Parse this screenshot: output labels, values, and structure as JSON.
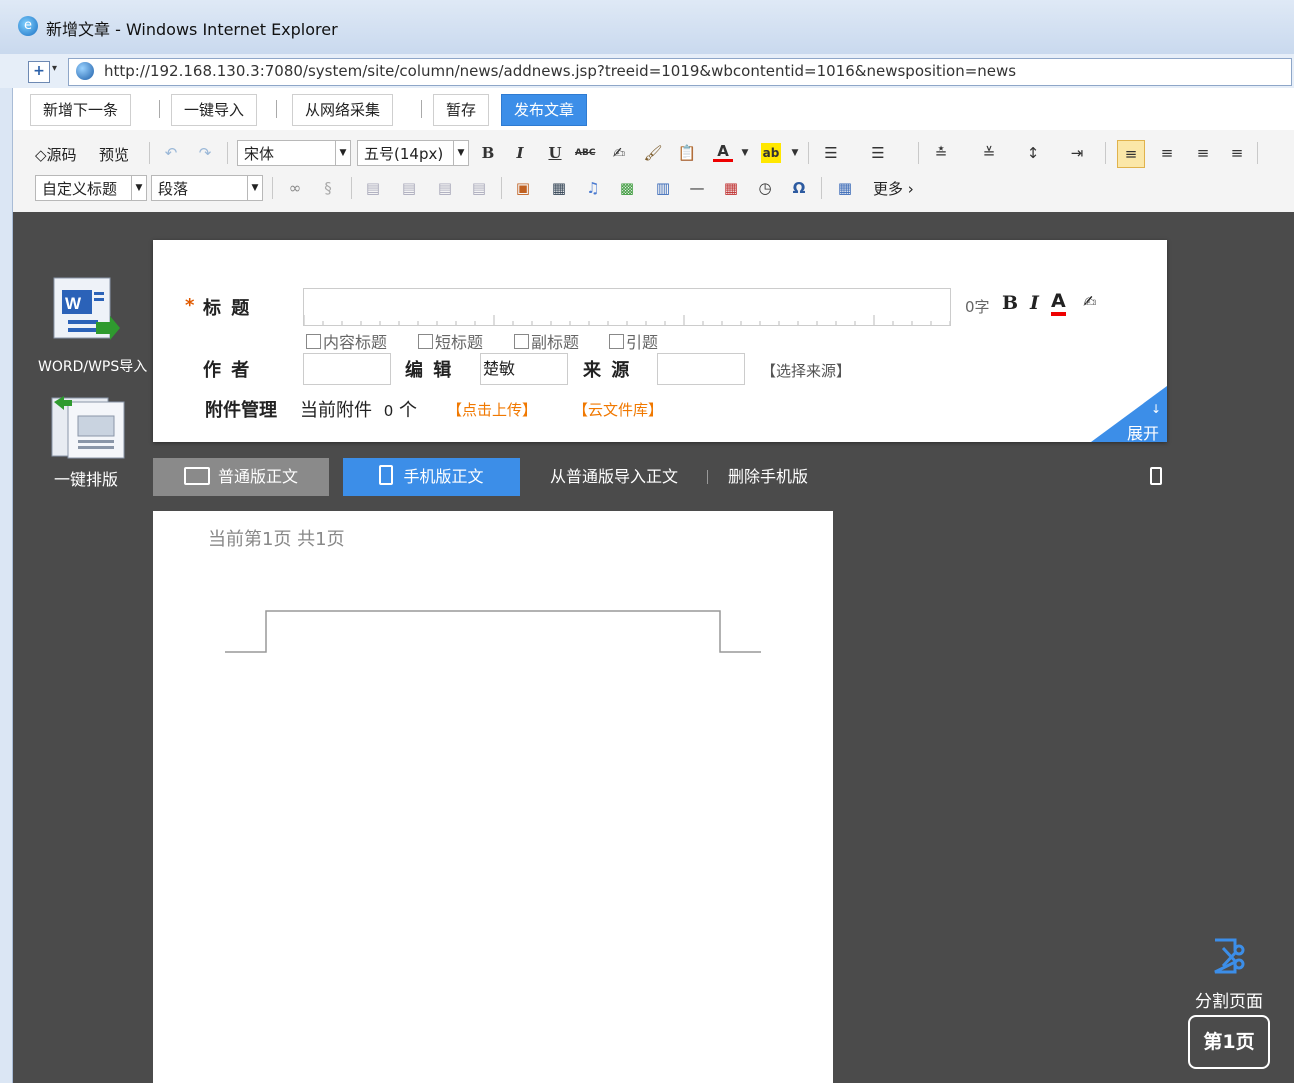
{
  "window": {
    "title": "新增文章 - Windows Internet Explorer"
  },
  "address": {
    "url": "http://192.168.130.3:7080/system/site/column/news/addnews.jsp?treeid=1019&wbcontentid=1016&newsposition=news"
  },
  "actions": {
    "add_next": "新增下一条",
    "import": "一键导入",
    "collect": "从网络采集",
    "save_draft": "暂存",
    "publish": "发布文章"
  },
  "toolbar": {
    "source": "◇源码",
    "preview": "预览",
    "font": "宋体",
    "size": "五号(14px)",
    "bold": "B",
    "italic": "I",
    "underline": "U",
    "strike": "ABC",
    "font_color": "A",
    "custom_heading": "自定义标题",
    "paragraph": "段落",
    "more": "更多 ›",
    "omega": "Ω"
  },
  "sidebar": {
    "word_import": "WORD/WPS导入",
    "one_click_layout": "一键排版"
  },
  "form": {
    "required_mark": "*",
    "title_label": "标 题",
    "title_value": "",
    "char_count": "0字",
    "fmt_bold": "B",
    "fmt_italic": "I",
    "fmt_color": "A",
    "checkboxes": [
      "内容标题",
      "短标题",
      "副标题",
      "引题"
    ],
    "author_label": "作 者",
    "author_value": "",
    "editor_label": "编 辑",
    "editor_value": "楚敏",
    "source_label": "来 源",
    "source_value": "",
    "select_source": "【选择来源】",
    "attach_label": "附件管理",
    "attach_current": "当前附件",
    "attach_count": "0",
    "attach_unit": "个",
    "upload": "【点击上传】",
    "cloud": "【云文件库】",
    "expand": "展开",
    "expand_arrow": "↓"
  },
  "tabs": {
    "normal": "普通版正文",
    "mobile": "手机版正文",
    "import_normal": "从普通版导入正文",
    "delete_mobile": "删除手机版"
  },
  "page": {
    "info": "当前第1页 共1页"
  },
  "right": {
    "split": "分割页面",
    "page_btn": "第1页"
  },
  "colors": {
    "accent": "#3c8ee8",
    "work_bg": "#4b4b4b",
    "orange": "#f07800",
    "required": "#e05a00"
  }
}
